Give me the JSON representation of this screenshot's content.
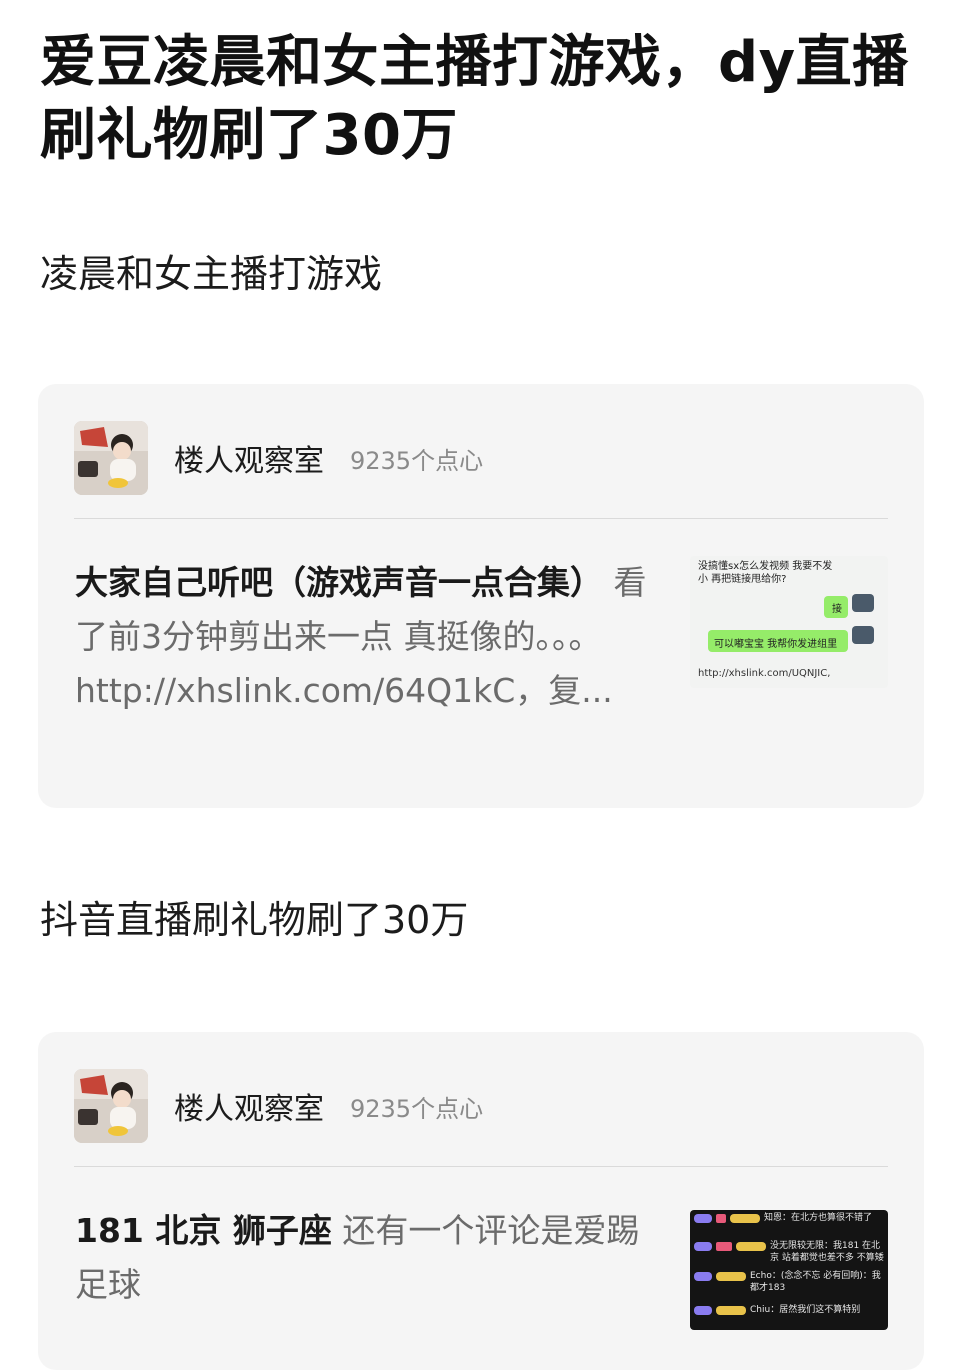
{
  "title": "爱豆凌晨和女主播打游戏，dy直播刷礼物刷了30万",
  "section1": {
    "text": "凌晨和女主播打游戏"
  },
  "card1": {
    "author": "楼人观察室",
    "hearts": "9235个点心",
    "text_bold": "大家自己听吧（游戏声音一点合集）",
    "text_body": " 看了前3分钟剪出来一点 真挺像的。。。",
    "text_link": "http://xhslink.com/64Q1kC，复...",
    "thumb": {
      "line1": "没搞懂sx怎么发视频 我要不发",
      "line2": "小 再把链接甩给你?",
      "reply1": "接",
      "reply2": "可以嘟宝宝 我帮你发进组里",
      "link": "http://xhslink.com/UQNJIC,"
    }
  },
  "section2": {
    "text": "抖音直播刷礼物刷了30万"
  },
  "card2": {
    "author": "楼人观察室",
    "hearts": "9235个点心",
    "text_bold": "181 北京 狮子座",
    "text_body": " 还有一个评论是爱踢足球",
    "thumb": {
      "c1": "知恩：在北方也算很不错了",
      "c2": "没无限较无限：我181 在北京 站着都觉也差不多 不算矮",
      "c3": "Echo：(念念不忘 必有回响)：我都才183",
      "c4": "Chiu：居然我们这不算特别"
    }
  },
  "colors": {
    "background": "#ffffff",
    "card": "#f5f5f5",
    "secondary_text": "#6b6b6b",
    "chat_bubble_green": "#95ec69"
  }
}
